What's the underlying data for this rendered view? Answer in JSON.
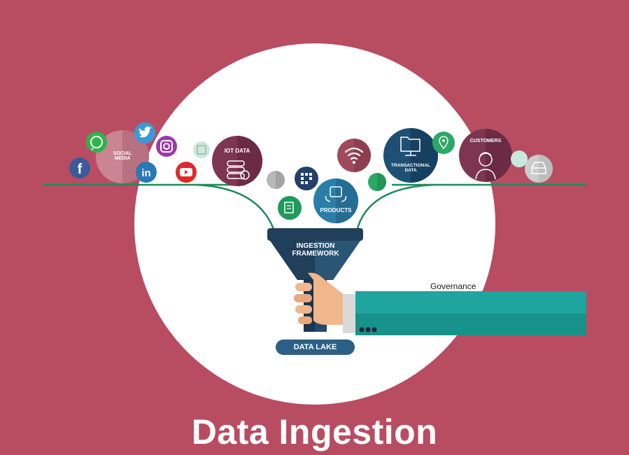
{
  "title": "Data Ingestion",
  "sources": {
    "social_media": "SOCIAL MEDIA",
    "iot_data": "IOT DATA",
    "products": "PRODUCTS",
    "transactional_data": "TRANSACTIONAL DATA",
    "customers": "CUSTOMERS"
  },
  "funnel_label": "INGESTION FRAMEWORK",
  "output_label": "DATA LAKE",
  "governance_label": "Governance",
  "colors": {
    "background": "#b84d62",
    "circle": "#ffffff",
    "line": "#1f8a5a",
    "funnel": "#1f3f5b",
    "sleeve": "#1ea59e",
    "data_lake": "#2b5f86"
  },
  "icons": {
    "social": [
      "whatsapp-icon",
      "twitter-icon",
      "instagram-icon",
      "facebook-icon",
      "linkedin-icon",
      "youtube-icon"
    ],
    "other": [
      "wifi-icon",
      "folder-icon",
      "location-pin-icon",
      "customer-avatar-icon",
      "document-icon",
      "product-box-icon",
      "database-icon",
      "inbox-icon"
    ]
  }
}
